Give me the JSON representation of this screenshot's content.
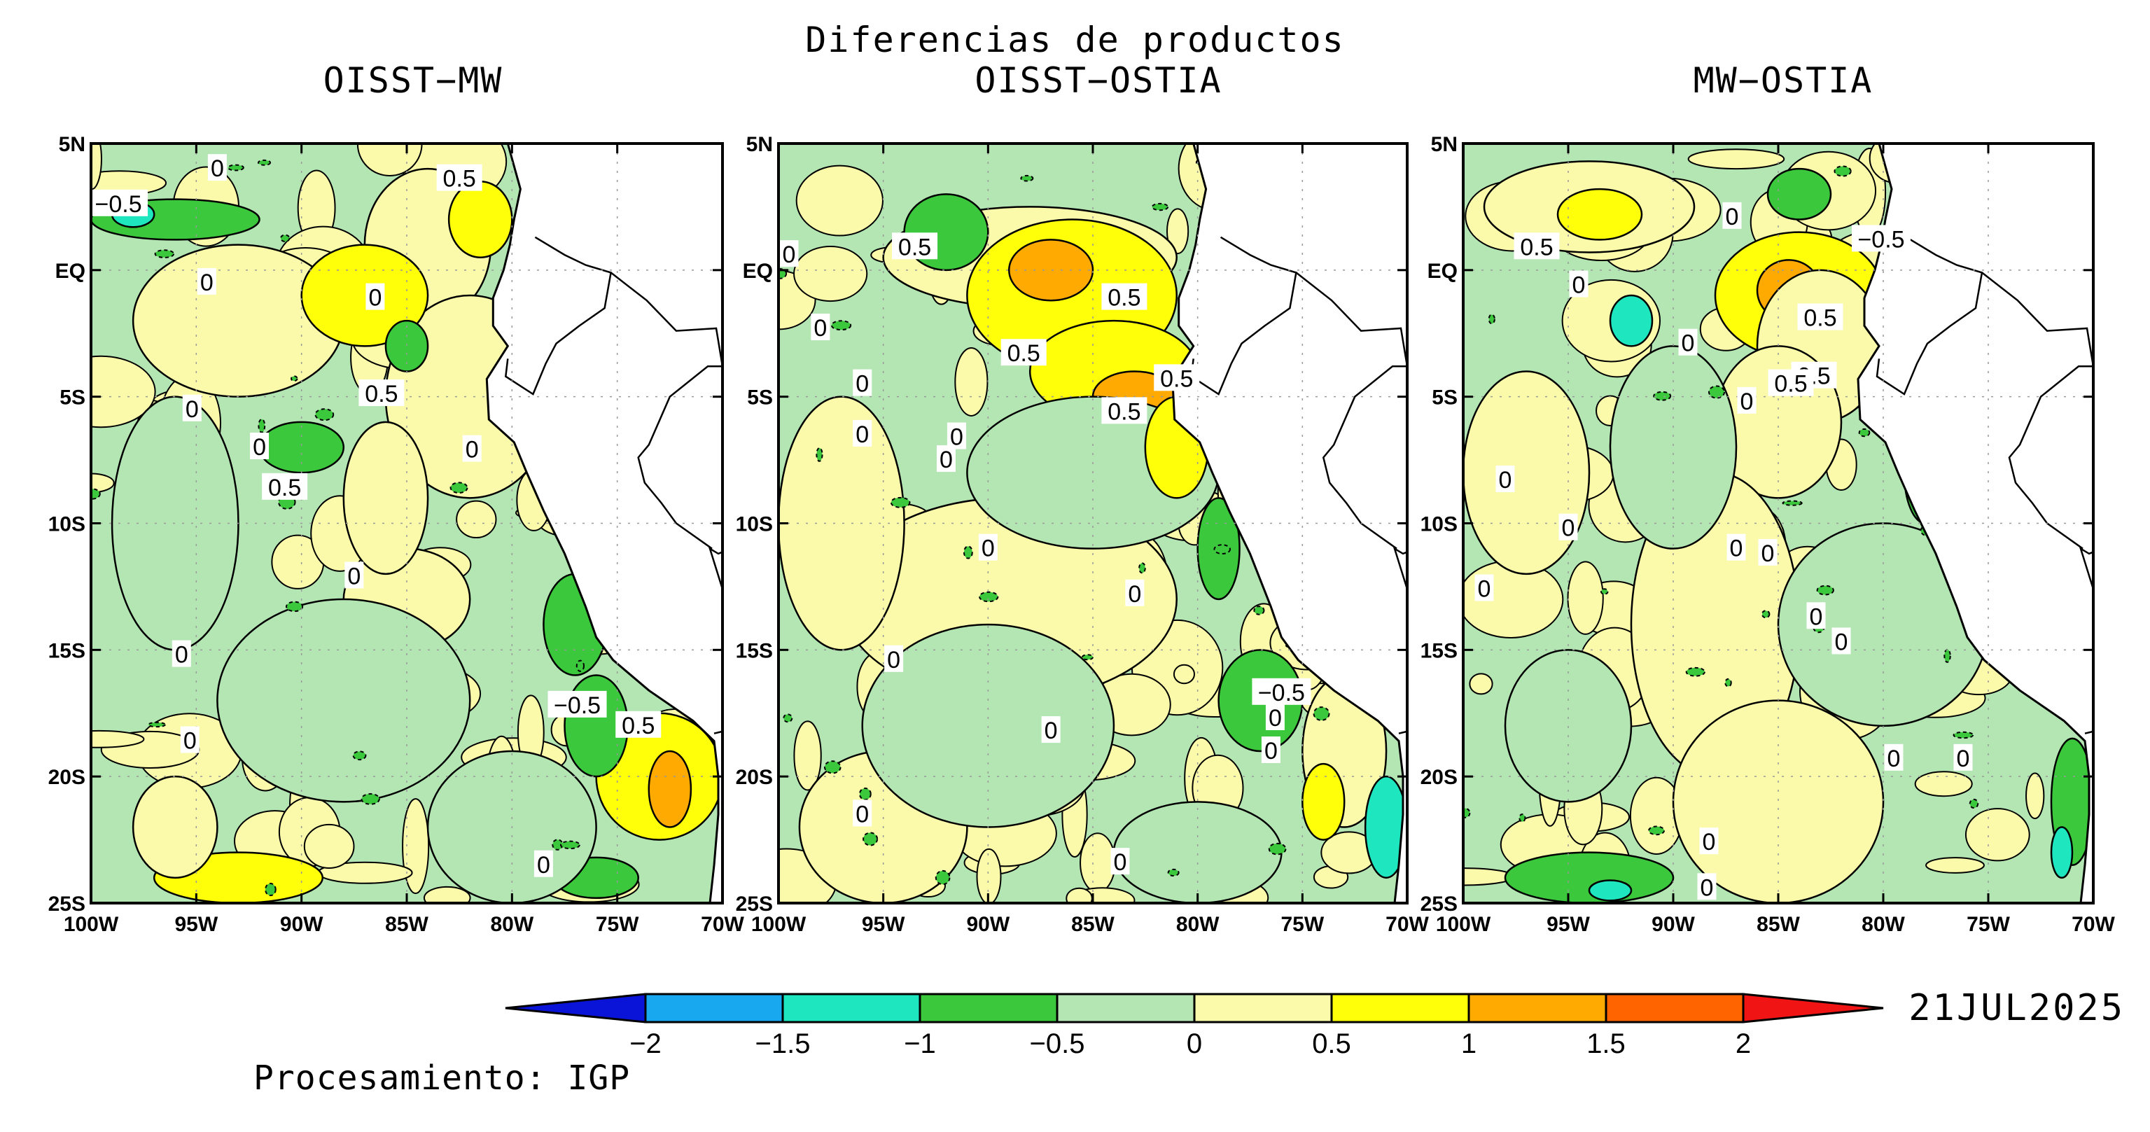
{
  "title": "Diferencias de productos",
  "panels": [
    {
      "title": "OISST−MW",
      "clabels": [
        "−0.5",
        "0",
        "0.5",
        "0",
        "0",
        "0.5",
        "0",
        "0",
        "0.5",
        "0",
        "0",
        "0",
        "−0.5",
        "0",
        "0.5",
        "0"
      ]
    },
    {
      "title": "OISST−OSTIA",
      "clabels": [
        "0",
        "0.5",
        "0.5",
        "0",
        "0.5",
        "0",
        "0.5",
        "0",
        "0.5",
        "0",
        "0",
        "0",
        "0",
        "0",
        "−0.5",
        "0",
        "0",
        "0",
        "0",
        "0"
      ]
    },
    {
      "title": "MW−OSTIA",
      "clabels": [
        "0.5",
        "0",
        "−0.5",
        "0",
        "0.5",
        "0",
        "0.5",
        "0",
        "0.5",
        "0",
        "0",
        "0",
        "0",
        "0",
        "0",
        "0",
        "0",
        "0",
        "0",
        "0"
      ]
    }
  ],
  "y_ticks": [
    "5N",
    "EQ",
    "5S",
    "10S",
    "15S",
    "20S",
    "25S"
  ],
  "x_ticks": [
    "100W",
    "95W",
    "90W",
    "85W",
    "80W",
    "75W",
    "70W"
  ],
  "colorbar": {
    "ticks": [
      "−2",
      "−1.5",
      "−1",
      "−0.5",
      "0",
      "0.5",
      "1",
      "1.5",
      "2"
    ],
    "colors": [
      "#0a14d8",
      "#18a8f0",
      "#1ee6be",
      "#3cc83c",
      "#b4e6b4",
      "#fafaaa",
      "#ffff0a",
      "#ffaa00",
      "#ff6400",
      "#f01414"
    ]
  },
  "date": "21JUL2025",
  "credit": "Procesamiento: IGP"
}
